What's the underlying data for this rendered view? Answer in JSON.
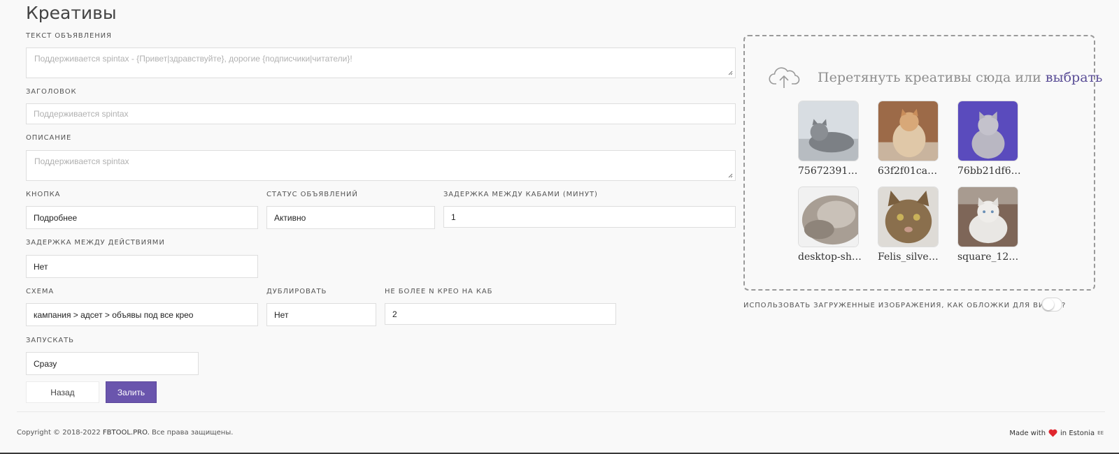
{
  "page": {
    "title": "Креативы"
  },
  "form": {
    "ad_text": {
      "label": "ТЕКСТ ОБЪЯВЛЕНИЯ",
      "placeholder": "Поддерживается spintax - {Привет|здравствуйте}, дорогие {подписчики|читатели}!"
    },
    "headline": {
      "label": "ЗАГОЛОВОК",
      "placeholder": "Поддерживается spintax"
    },
    "description": {
      "label": "ОПИСАНИЕ",
      "placeholder": "Поддерживается spintax"
    },
    "button": {
      "label": "КНОПКА",
      "value": "Подробнее"
    },
    "ad_status": {
      "label": "СТАТУС ОБЪЯВЛЕНИЙ",
      "value": "Активно"
    },
    "cab_delay": {
      "label": "ЗАДЕРЖКА МЕЖДУ КАБАМИ (МИНУТ)",
      "value": "1"
    },
    "action_delay": {
      "label": "ЗАДЕРЖКА МЕЖДУ ДЕЙСТВИЯМИ",
      "value": "Нет"
    },
    "scheme": {
      "label": "СХЕМА",
      "value": "кампания > адсет > объявы под все крео"
    },
    "duplicate": {
      "label": "ДУБЛИРОВАТЬ",
      "value": "Нет"
    },
    "max_creo": {
      "label": "НЕ БОЛЕЕ N КРЕО НА КАБ",
      "value": "2"
    },
    "launch": {
      "label": "ЗАПУСКАТЬ",
      "value": "Сразу"
    },
    "back_label": "Назад",
    "submit_label": "Залить"
  },
  "dropzone": {
    "text": "Перетянуть креативы сюда или",
    "link": "выбрать",
    "files": [
      {
        "name": "75672391…",
        "icon": "cat-photo"
      },
      {
        "name": "63f2f01ca…",
        "icon": "cat-photo"
      },
      {
        "name": "76bb21df6…",
        "icon": "cat-photo"
      },
      {
        "name": "desktop-sh…",
        "icon": "cat-photo"
      },
      {
        "name": "Felis_silve…",
        "icon": "cat-photo"
      },
      {
        "name": "square_12…",
        "icon": "cat-photo"
      }
    ]
  },
  "video_cover_toggle": {
    "label": "ИСПОЛЬЗОВАТЬ ЗАГРУЖЕННЫЕ ИЗОБРАЖЕНИЯ, КАК ОБЛОЖКИ ДЛЯ ВИДЕО?",
    "on": false
  },
  "footer": {
    "copyright_prefix": "Copyright © 2018-2022",
    "brand": "FBTOOL.PRO.",
    "rights": "Все права защищены.",
    "made_with": "Made with",
    "in_location": "in Estonia",
    "country_code": "EE"
  },
  "colors": {
    "accent": "#6a55ad",
    "link": "#5a4d96",
    "heart": "#e0262e"
  }
}
